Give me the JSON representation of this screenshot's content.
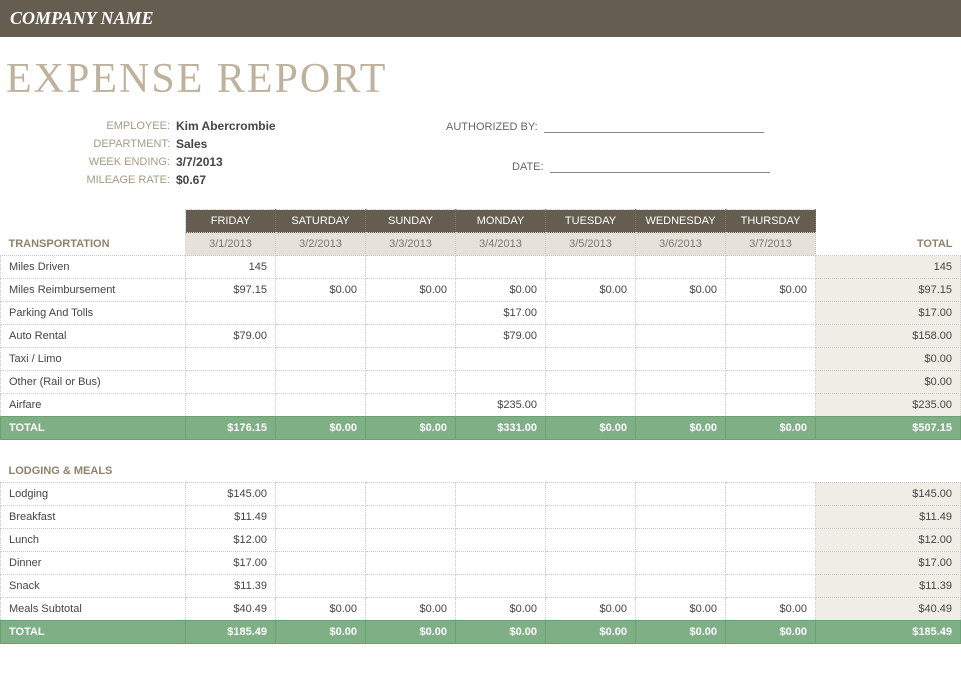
{
  "company_name": "COMPANY NAME",
  "title": "EXPENSE REPORT",
  "meta": {
    "employee_label": "EMPLOYEE:",
    "employee_value": "Kim Abercrombie",
    "department_label": "DEPARTMENT:",
    "department_value": "Sales",
    "week_ending_label": "WEEK ENDING:",
    "week_ending_value": "3/7/2013",
    "mileage_rate_label": "MILEAGE RATE:",
    "mileage_rate_value": "$0.67",
    "authorized_by_label": "AUTHORIZED BY:",
    "date_label": "DATE:"
  },
  "days": [
    "FRIDAY",
    "SATURDAY",
    "SUNDAY",
    "MONDAY",
    "TUESDAY",
    "WEDNESDAY",
    "THURSDAY"
  ],
  "dates": [
    "3/1/2013",
    "3/2/2013",
    "3/3/2013",
    "3/4/2013",
    "3/5/2013",
    "3/6/2013",
    "3/7/2013"
  ],
  "total_header": "TOTAL",
  "sections": [
    {
      "name": "TRANSPORTATION",
      "rows": [
        {
          "label": "Miles Driven",
          "cells": [
            "145",
            "",
            "",
            "",
            "",
            "",
            ""
          ],
          "total": "145"
        },
        {
          "label": "Miles Reimbursement",
          "cells": [
            "$97.15",
            "$0.00",
            "$0.00",
            "$0.00",
            "$0.00",
            "$0.00",
            "$0.00"
          ],
          "total": "$97.15"
        },
        {
          "label": "Parking And Tolls",
          "cells": [
            "",
            "",
            "",
            "$17.00",
            "",
            "",
            ""
          ],
          "total": "$17.00"
        },
        {
          "label": "Auto Rental",
          "cells": [
            "$79.00",
            "",
            "",
            "$79.00",
            "",
            "",
            ""
          ],
          "total": "$158.00"
        },
        {
          "label": "Taxi / Limo",
          "cells": [
            "",
            "",
            "",
            "",
            "",
            "",
            ""
          ],
          "total": "$0.00"
        },
        {
          "label": "Other (Rail or Bus)",
          "cells": [
            "",
            "",
            "",
            "",
            "",
            "",
            ""
          ],
          "total": "$0.00"
        },
        {
          "label": "Airfare",
          "cells": [
            "",
            "",
            "",
            "$235.00",
            "",
            "",
            ""
          ],
          "total": "$235.00"
        }
      ],
      "total": {
        "label": "TOTAL",
        "cells": [
          "$176.15",
          "$0.00",
          "$0.00",
          "$331.00",
          "$0.00",
          "$0.00",
          "$0.00"
        ],
        "total": "$507.15"
      }
    },
    {
      "name": "LODGING & MEALS",
      "rows": [
        {
          "label": "Lodging",
          "cells": [
            "$145.00",
            "",
            "",
            "",
            "",
            "",
            ""
          ],
          "total": "$145.00"
        },
        {
          "label": "Breakfast",
          "cells": [
            "$11.49",
            "",
            "",
            "",
            "",
            "",
            ""
          ],
          "total": "$11.49"
        },
        {
          "label": "Lunch",
          "cells": [
            "$12.00",
            "",
            "",
            "",
            "",
            "",
            ""
          ],
          "total": "$12.00"
        },
        {
          "label": "Dinner",
          "cells": [
            "$17.00",
            "",
            "",
            "",
            "",
            "",
            ""
          ],
          "total": "$17.00"
        },
        {
          "label": "Snack",
          "cells": [
            "$11.39",
            "",
            "",
            "",
            "",
            "",
            ""
          ],
          "total": "$11.39"
        },
        {
          "label": "Meals Subtotal",
          "cells": [
            "$40.49",
            "$0.00",
            "$0.00",
            "$0.00",
            "$0.00",
            "$0.00",
            "$0.00"
          ],
          "total": "$40.49"
        }
      ],
      "total": {
        "label": "TOTAL",
        "cells": [
          "$185.49",
          "$0.00",
          "$0.00",
          "$0.00",
          "$0.00",
          "$0.00",
          "$0.00"
        ],
        "total": "$185.49"
      }
    }
  ]
}
